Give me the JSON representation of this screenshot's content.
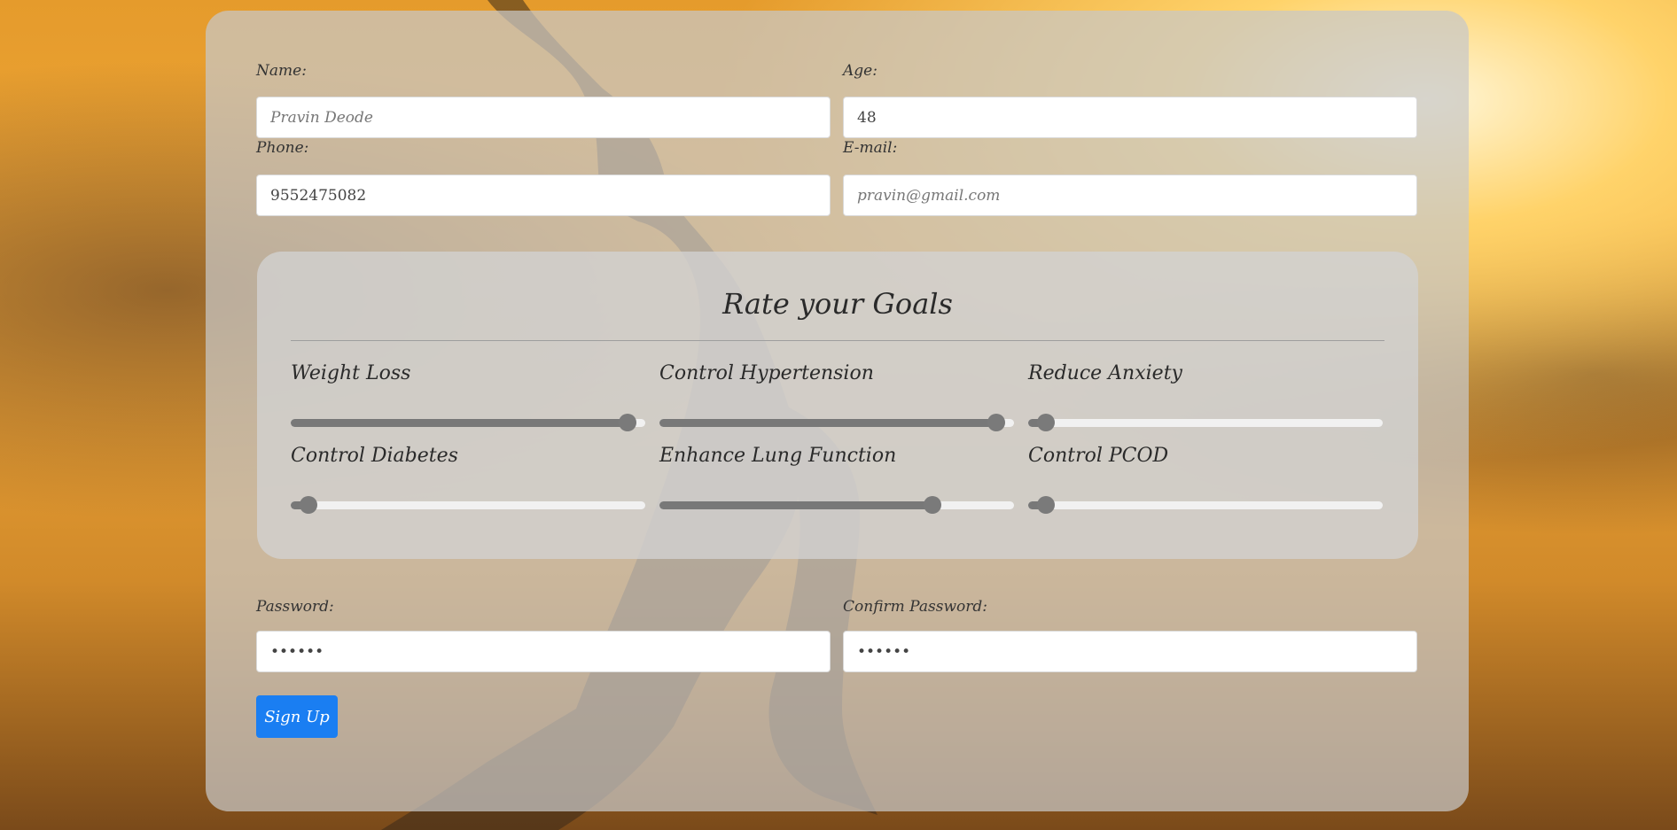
{
  "form": {
    "name": {
      "label": "Name:",
      "placeholder": "Pravin Deode"
    },
    "age": {
      "label": "Age:",
      "value": "48"
    },
    "phone": {
      "label": "Phone:",
      "value": "9552475082"
    },
    "email": {
      "label": "E-mail:",
      "placeholder": "pravin@gmail.com"
    },
    "password": {
      "label": "Password:",
      "value": "••••••"
    },
    "confirm_password": {
      "label": "Confirm Password:",
      "value": "••••••"
    },
    "signup_label": "Sign Up"
  },
  "goals": {
    "title": "Rate your Goals",
    "items": [
      {
        "label": "Weight Loss",
        "value": 0.95
      },
      {
        "label": "Control Hypertension",
        "value": 0.95
      },
      {
        "label": "Reduce Anxiety",
        "value": 0.05
      },
      {
        "label": "Control Diabetes",
        "value": 0.05
      },
      {
        "label": "Enhance Lung Function",
        "value": 0.77
      },
      {
        "label": "Control PCOD",
        "value": 0.05
      }
    ]
  },
  "colors": {
    "button": "#1a7ef2",
    "slider_fill": "#787878",
    "card": "#c8c8c8"
  }
}
